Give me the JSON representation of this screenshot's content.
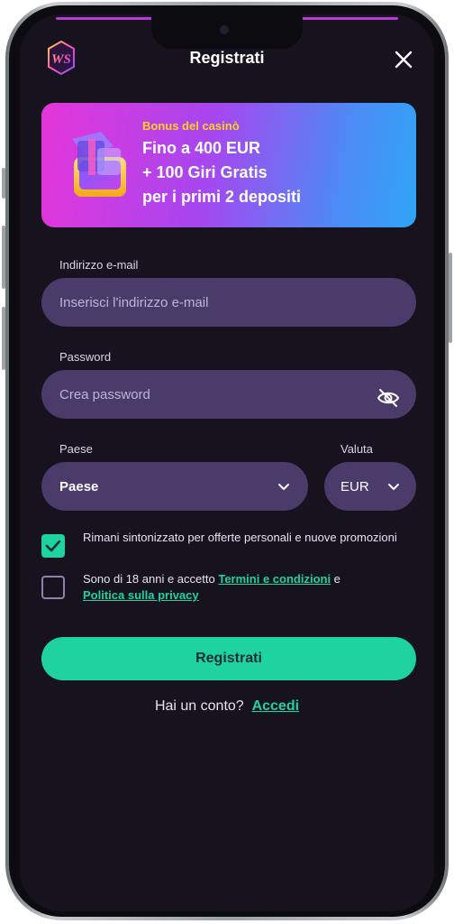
{
  "header": {
    "title": "Registrati",
    "logo_text": "WS"
  },
  "banner": {
    "label": "Bonus del casinò",
    "line1": "Fino a 400 EUR",
    "line2": "+ 100 Giri Gratis",
    "line3": "per i primi 2 depositi"
  },
  "form": {
    "email_label": "Indirizzo e-mail",
    "email_placeholder": "Inserisci l'indirizzo e-mail",
    "password_label": "Password",
    "password_placeholder": "Crea password",
    "country_label": "Paese",
    "country_value": "Paese",
    "currency_label": "Valuta",
    "currency_value": "EUR"
  },
  "consent": {
    "promo_text": "Rimani sintonizzato per offerte personali e nuove promozioni",
    "promo_checked": true,
    "terms_prefix": "Sono di 18 anni e accetto ",
    "terms_link": "Termini e condizioni",
    "terms_and": " e",
    "privacy_link": "Politica sulla privacy",
    "terms_checked": false
  },
  "actions": {
    "register_label": "Registrati",
    "login_prompt": "Hai un conto?",
    "login_link": "Accedi"
  },
  "colors": {
    "background": "#16131f",
    "field": "#4a3b6b",
    "accent": "#1fd3a0",
    "bonus_label": "#ffd21a"
  }
}
